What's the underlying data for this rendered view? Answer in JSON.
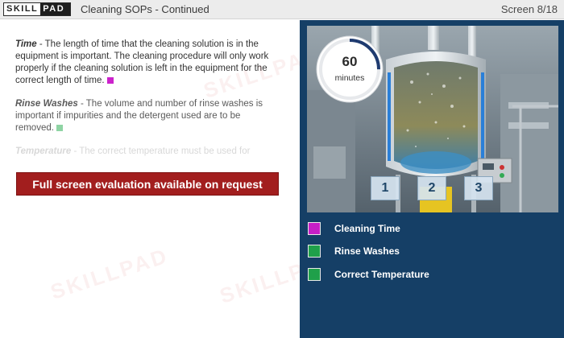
{
  "header": {
    "logo_left": "SKILL",
    "logo_right": "PAD",
    "title": "Cleaning SOPs - Continued",
    "screen_counter": "Screen 8/18"
  },
  "content": {
    "paragraphs": [
      {
        "term": "Time",
        "text": " - The length of time that the cleaning solution is in the equipment is important. The cleaning procedure will only work properly if the cleaning solution is left in the equipment for the correct length of time.",
        "marker_color": "#cc22cc"
      },
      {
        "term": "Rinse Washes",
        "text": " - The volume and number of rinse washes is important if impurities and the detergent used are to be removed.",
        "marker_color": "#8fd4a4"
      },
      {
        "term": "Temperature",
        "text": " - The correct temperature must be used for"
      }
    ],
    "eval_banner": "Full screen evaluation available on request"
  },
  "watermark": "SKILLPAD",
  "illustration": {
    "timer_value": "60",
    "timer_unit": "minutes",
    "timer_progress": 0.25,
    "labels": [
      "1",
      "2",
      "3"
    ]
  },
  "legend": [
    {
      "label": "Cleaning Time",
      "color": "#c61fc6"
    },
    {
      "label": "Rinse Washes",
      "color": "#1fa04a"
    },
    {
      "label": "Correct Temperature",
      "color": "#1fa04a"
    }
  ]
}
